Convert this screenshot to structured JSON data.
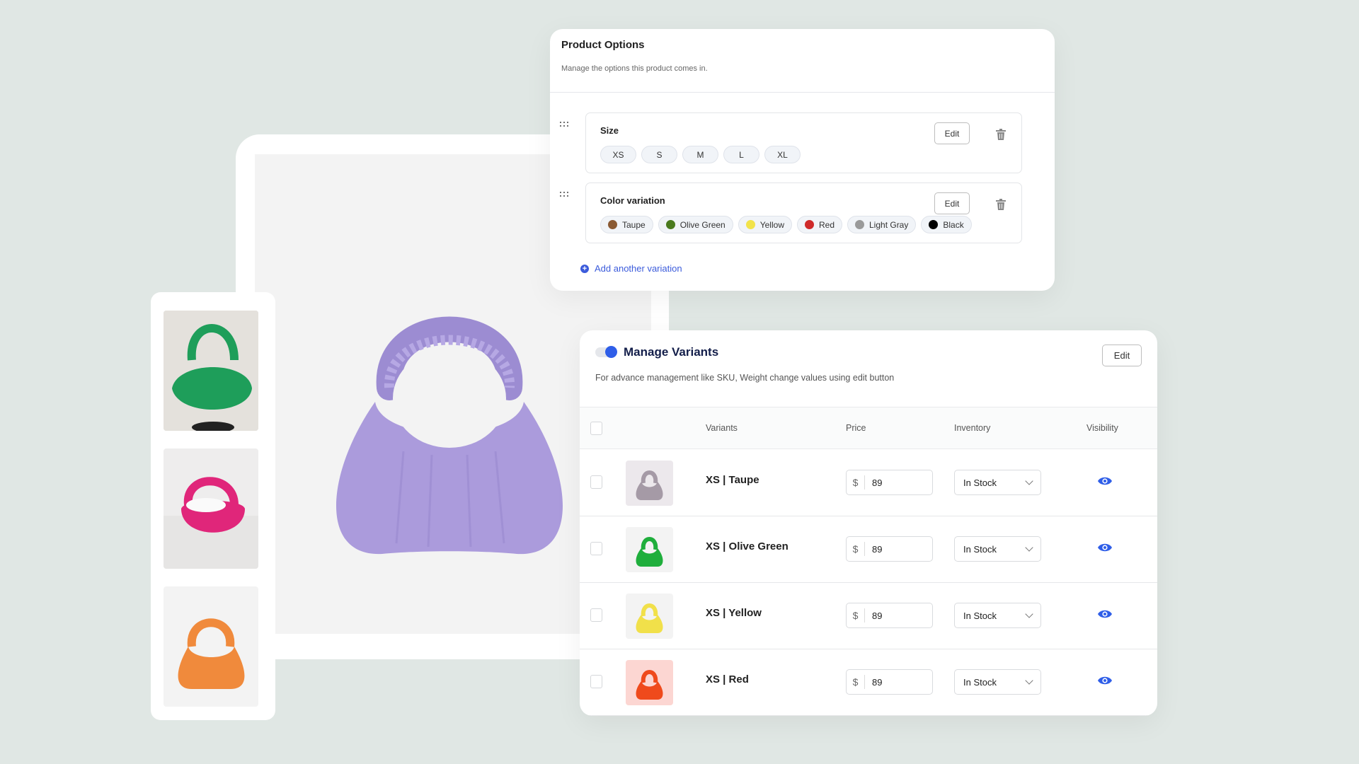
{
  "product_options": {
    "title": "Product Options",
    "subtitle": "Manage the options this product comes in.",
    "options": [
      {
        "label": "Size",
        "edit_label": "Edit",
        "values": [
          "XS",
          "S",
          "M",
          "L",
          "XL"
        ]
      },
      {
        "label": "Color variation",
        "edit_label": "Edit",
        "values": [
          {
            "name": "Taupe",
            "color": "#8a5a33"
          },
          {
            "name": "Olive Green",
            "color": "#4a7a1e"
          },
          {
            "name": "Yellow",
            "color": "#f2e34a"
          },
          {
            "name": "Red",
            "color": "#cf2a2a"
          },
          {
            "name": "Light Gray",
            "color": "#9a9a9a"
          },
          {
            "name": "Black",
            "color": "#000000"
          }
        ]
      }
    ],
    "add_variation_label": "Add another variation"
  },
  "gallery": {
    "main_image": {
      "alt": "Lavender ruched handbag",
      "color": "#ab9bdc"
    },
    "thumbnails": [
      {
        "alt": "Green ruched handbag",
        "color": "#1e9e5a"
      },
      {
        "alt": "Pink ruched handbag",
        "color": "#e0267a"
      },
      {
        "alt": "Orange ruched handbag",
        "color": "#f08a3c"
      }
    ]
  },
  "manage_variants": {
    "toggle_on": true,
    "title": "Manage Variants",
    "subtitle": "For advance management like SKU, Weight change values using edit button",
    "edit_label": "Edit",
    "columns": [
      "Variants",
      "Price",
      "Inventory",
      "Visibility"
    ],
    "rows": [
      {
        "name": "XS | Taupe",
        "currency": "$",
        "price": "89",
        "inventory": "In Stock",
        "visible": true,
        "thumb_bg": "#ece8ec",
        "bag_color": "#a59aa6"
      },
      {
        "name": "XS | Olive Green",
        "currency": "$",
        "price": "89",
        "inventory": "In Stock",
        "visible": true,
        "thumb_bg": "#f3f3f3",
        "bag_color": "#1fae3c"
      },
      {
        "name": "XS | Yellow",
        "currency": "$",
        "price": "89",
        "inventory": "In Stock",
        "visible": true,
        "thumb_bg": "#f3f3f3",
        "bag_color": "#f1e04a"
      },
      {
        "name": "XS | Red",
        "currency": "$",
        "price": "89",
        "inventory": "In Stock",
        "visible": true,
        "thumb_bg": "#fcd6d2",
        "bag_color": "#ef4a1c"
      }
    ]
  },
  "colors": {
    "accent": "#2f5ee8",
    "link": "#3b5bdb",
    "background": "#e0e7e4"
  }
}
